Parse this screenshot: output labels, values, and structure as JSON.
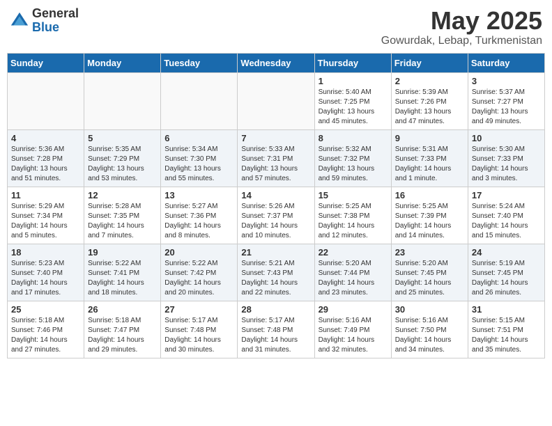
{
  "header": {
    "logo_general": "General",
    "logo_blue": "Blue",
    "month_year": "May 2025",
    "location": "Gowurdak, Lebap, Turkmenistan"
  },
  "days_of_week": [
    "Sunday",
    "Monday",
    "Tuesday",
    "Wednesday",
    "Thursday",
    "Friday",
    "Saturday"
  ],
  "weeks": [
    [
      {
        "day": "",
        "content": ""
      },
      {
        "day": "",
        "content": ""
      },
      {
        "day": "",
        "content": ""
      },
      {
        "day": "",
        "content": ""
      },
      {
        "day": "1",
        "content": "Sunrise: 5:40 AM\nSunset: 7:25 PM\nDaylight: 13 hours\nand 45 minutes."
      },
      {
        "day": "2",
        "content": "Sunrise: 5:39 AM\nSunset: 7:26 PM\nDaylight: 13 hours\nand 47 minutes."
      },
      {
        "day": "3",
        "content": "Sunrise: 5:37 AM\nSunset: 7:27 PM\nDaylight: 13 hours\nand 49 minutes."
      }
    ],
    [
      {
        "day": "4",
        "content": "Sunrise: 5:36 AM\nSunset: 7:28 PM\nDaylight: 13 hours\nand 51 minutes."
      },
      {
        "day": "5",
        "content": "Sunrise: 5:35 AM\nSunset: 7:29 PM\nDaylight: 13 hours\nand 53 minutes."
      },
      {
        "day": "6",
        "content": "Sunrise: 5:34 AM\nSunset: 7:30 PM\nDaylight: 13 hours\nand 55 minutes."
      },
      {
        "day": "7",
        "content": "Sunrise: 5:33 AM\nSunset: 7:31 PM\nDaylight: 13 hours\nand 57 minutes."
      },
      {
        "day": "8",
        "content": "Sunrise: 5:32 AM\nSunset: 7:32 PM\nDaylight: 13 hours\nand 59 minutes."
      },
      {
        "day": "9",
        "content": "Sunrise: 5:31 AM\nSunset: 7:33 PM\nDaylight: 14 hours\nand 1 minute."
      },
      {
        "day": "10",
        "content": "Sunrise: 5:30 AM\nSunset: 7:33 PM\nDaylight: 14 hours\nand 3 minutes."
      }
    ],
    [
      {
        "day": "11",
        "content": "Sunrise: 5:29 AM\nSunset: 7:34 PM\nDaylight: 14 hours\nand 5 minutes."
      },
      {
        "day": "12",
        "content": "Sunrise: 5:28 AM\nSunset: 7:35 PM\nDaylight: 14 hours\nand 7 minutes."
      },
      {
        "day": "13",
        "content": "Sunrise: 5:27 AM\nSunset: 7:36 PM\nDaylight: 14 hours\nand 8 minutes."
      },
      {
        "day": "14",
        "content": "Sunrise: 5:26 AM\nSunset: 7:37 PM\nDaylight: 14 hours\nand 10 minutes."
      },
      {
        "day": "15",
        "content": "Sunrise: 5:25 AM\nSunset: 7:38 PM\nDaylight: 14 hours\nand 12 minutes."
      },
      {
        "day": "16",
        "content": "Sunrise: 5:25 AM\nSunset: 7:39 PM\nDaylight: 14 hours\nand 14 minutes."
      },
      {
        "day": "17",
        "content": "Sunrise: 5:24 AM\nSunset: 7:40 PM\nDaylight: 14 hours\nand 15 minutes."
      }
    ],
    [
      {
        "day": "18",
        "content": "Sunrise: 5:23 AM\nSunset: 7:40 PM\nDaylight: 14 hours\nand 17 minutes."
      },
      {
        "day": "19",
        "content": "Sunrise: 5:22 AM\nSunset: 7:41 PM\nDaylight: 14 hours\nand 18 minutes."
      },
      {
        "day": "20",
        "content": "Sunrise: 5:22 AM\nSunset: 7:42 PM\nDaylight: 14 hours\nand 20 minutes."
      },
      {
        "day": "21",
        "content": "Sunrise: 5:21 AM\nSunset: 7:43 PM\nDaylight: 14 hours\nand 22 minutes."
      },
      {
        "day": "22",
        "content": "Sunrise: 5:20 AM\nSunset: 7:44 PM\nDaylight: 14 hours\nand 23 minutes."
      },
      {
        "day": "23",
        "content": "Sunrise: 5:20 AM\nSunset: 7:45 PM\nDaylight: 14 hours\nand 25 minutes."
      },
      {
        "day": "24",
        "content": "Sunrise: 5:19 AM\nSunset: 7:45 PM\nDaylight: 14 hours\nand 26 minutes."
      }
    ],
    [
      {
        "day": "25",
        "content": "Sunrise: 5:18 AM\nSunset: 7:46 PM\nDaylight: 14 hours\nand 27 minutes."
      },
      {
        "day": "26",
        "content": "Sunrise: 5:18 AM\nSunset: 7:47 PM\nDaylight: 14 hours\nand 29 minutes."
      },
      {
        "day": "27",
        "content": "Sunrise: 5:17 AM\nSunset: 7:48 PM\nDaylight: 14 hours\nand 30 minutes."
      },
      {
        "day": "28",
        "content": "Sunrise: 5:17 AM\nSunset: 7:48 PM\nDaylight: 14 hours\nand 31 minutes."
      },
      {
        "day": "29",
        "content": "Sunrise: 5:16 AM\nSunset: 7:49 PM\nDaylight: 14 hours\nand 32 minutes."
      },
      {
        "day": "30",
        "content": "Sunrise: 5:16 AM\nSunset: 7:50 PM\nDaylight: 14 hours\nand 34 minutes."
      },
      {
        "day": "31",
        "content": "Sunrise: 5:15 AM\nSunset: 7:51 PM\nDaylight: 14 hours\nand 35 minutes."
      }
    ]
  ]
}
